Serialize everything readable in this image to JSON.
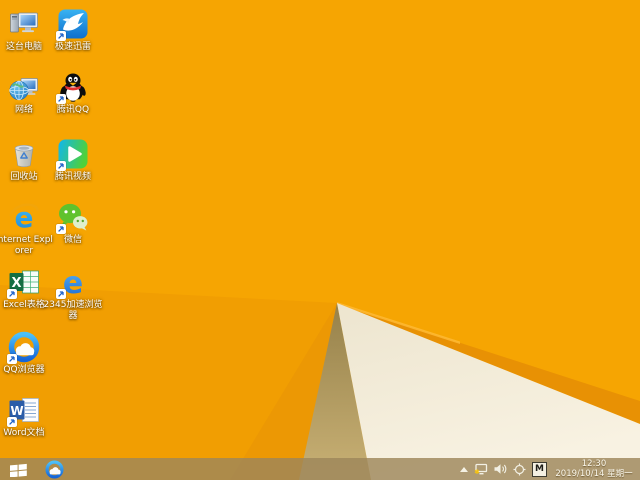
{
  "desktop": {
    "icons": [
      {
        "name": "this-pc",
        "label": "这台电脑",
        "icon": "computer-icon",
        "shortcut": false
      },
      {
        "name": "xunlei",
        "label": "极速迅雷",
        "icon": "thunder-bird-icon",
        "shortcut": true
      },
      {
        "name": "network",
        "label": "网络",
        "icon": "globe-monitor-icon",
        "shortcut": false
      },
      {
        "name": "tencent-qq",
        "label": "腾讯QQ",
        "icon": "qq-penguin-icon",
        "shortcut": true
      },
      {
        "name": "recycle-bin",
        "label": "回收站",
        "icon": "recycle-bin-icon",
        "shortcut": false
      },
      {
        "name": "tencent-video",
        "label": "腾讯视频",
        "icon": "play-button-icon",
        "shortcut": true
      },
      {
        "name": "internet-explorer",
        "label": "Internet Explorer",
        "icon": "ie-e-icon",
        "shortcut": false
      },
      {
        "name": "wechat",
        "label": "微信",
        "icon": "wechat-bubbles-icon",
        "shortcut": true
      },
      {
        "name": "excel",
        "label": "Excel表格",
        "icon": "excel-icon",
        "shortcut": true
      },
      {
        "name": "browser-2345",
        "label": "2345加速浏览器",
        "icon": "blue-e-icon",
        "shortcut": true
      },
      {
        "name": "qq-browser",
        "label": "QQ浏览器",
        "icon": "qq-browser-cloud-icon",
        "shortcut": true
      },
      {
        "name": "word",
        "label": "Word文档",
        "icon": "word-icon",
        "shortcut": true
      }
    ]
  },
  "taskbar": {
    "pinned": [
      {
        "name": "qq-browser",
        "icon": "qq-browser-cloud-icon"
      }
    ],
    "tray": {
      "icon_names": [
        "hidden-icons-chevron",
        "network-status-icon",
        "volume-icon",
        "target-app-icon",
        "input-method-indicator"
      ],
      "input_indicator": "M",
      "clock": {
        "time": "12:30",
        "date": "2019/10/14 星期一"
      }
    }
  },
  "colors": {
    "wallpaper_main": "#F6A502",
    "wallpaper_shade": "#F19E02",
    "wallpaper_deep": "#EC9804",
    "wallpaper_edge_band": "#E89104",
    "wallpaper_olive_top": "#96814A",
    "wallpaper_olive_bottom": "#C9B175",
    "wallpaper_cream": "#F3ECD8",
    "taskbar_tint": "#9E8658"
  }
}
